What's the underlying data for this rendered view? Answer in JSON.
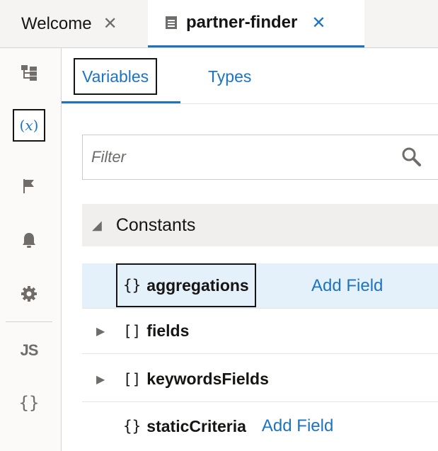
{
  "tabs": [
    {
      "label": "Welcome",
      "close": "✕"
    },
    {
      "label": "partner-finder",
      "close": "✕"
    }
  ],
  "rail": {
    "items": [
      {
        "icon": "structure-icon"
      },
      {
        "icon": "variable-icon",
        "text": "(x)",
        "selected": true
      },
      {
        "icon": "flag-icon"
      },
      {
        "icon": "bell-icon"
      },
      {
        "icon": "gear-icon"
      },
      {
        "icon": "js-icon",
        "text": "JS"
      },
      {
        "icon": "braces-icon",
        "text": "{}"
      }
    ]
  },
  "subtabs": {
    "variables": "Variables",
    "types": "Types"
  },
  "filter": {
    "placeholder": "Filter",
    "value": ""
  },
  "tree": {
    "group": {
      "label": "Constants",
      "caret": "◢"
    },
    "rows": [
      {
        "glyph": "{}",
        "name": "aggregations",
        "action": "Add Field",
        "expandable": false,
        "selected": true
      },
      {
        "glyph": "[]",
        "name": "fields",
        "expandable": true
      },
      {
        "glyph": "[]",
        "name": "keywordsFields",
        "expandable": true
      },
      {
        "glyph": "{}",
        "name": "staticCriteria",
        "action": "Add Field",
        "expandable": false
      }
    ]
  },
  "colors": {
    "accent": "#1c74c1",
    "selected_row": "#e4f0fa",
    "group_bg": "#f1efed"
  }
}
